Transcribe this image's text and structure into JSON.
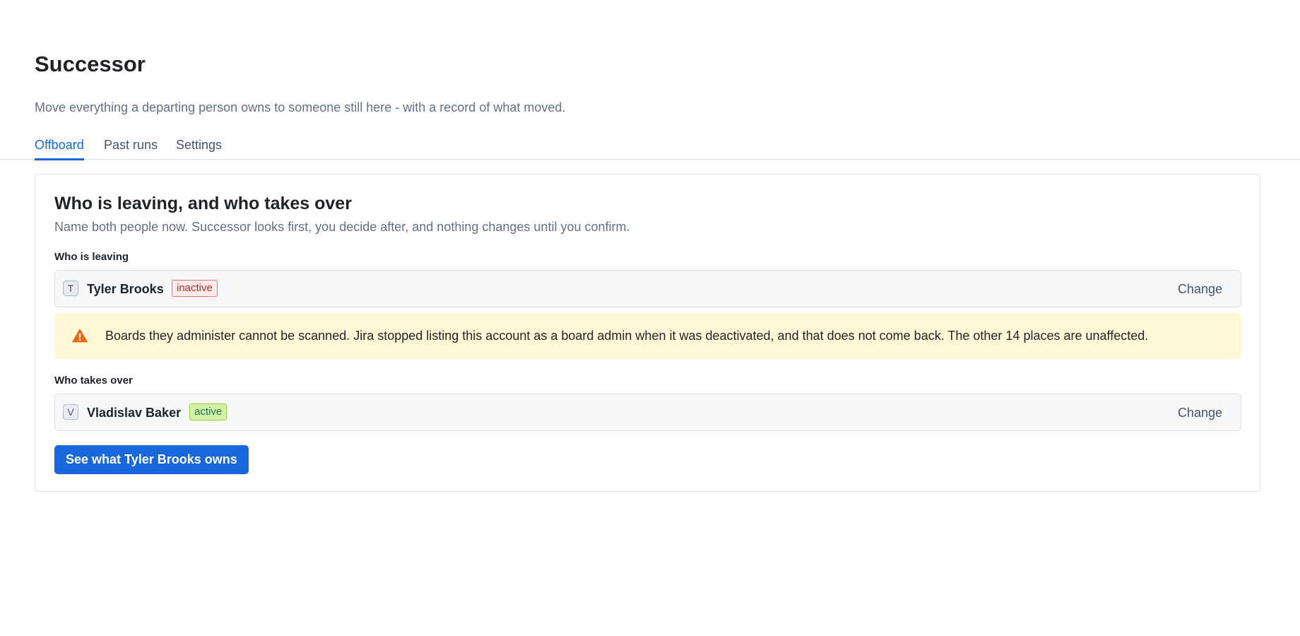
{
  "header": {
    "title": "Successor",
    "subtitle": "Move everything a departing person owns to someone still here - with a record of what moved."
  },
  "tabs": [
    {
      "label": "Offboard",
      "active": true
    },
    {
      "label": "Past runs",
      "active": false
    },
    {
      "label": "Settings",
      "active": false
    }
  ],
  "card": {
    "title": "Who is leaving, and who takes over",
    "description": "Name both people now. Successor looks first, you decide after, and nothing changes until you confirm.",
    "leaving": {
      "label": "Who is leaving",
      "initial": "T",
      "name": "Tyler Brooks",
      "status": "inactive",
      "change_label": "Change"
    },
    "warning": {
      "icon": "warning-triangle-icon",
      "text": "Boards they administer cannot be scanned. Jira stopped listing this account as a board admin when it was deactivated, and that does not come back. The other 14 places are unaffected."
    },
    "takes_over": {
      "label": "Who takes over",
      "initial": "V",
      "name": "Vladislav Baker",
      "status": "active",
      "change_label": "Change"
    },
    "primary_action": "See what Tyler Brooks owns"
  },
  "colors": {
    "accent": "#1868db",
    "warning_bg": "#fff7d6",
    "warning_icon": "#e56910",
    "inactive_bg": "#ffeceb",
    "active_bg": "#d3f1a7"
  }
}
